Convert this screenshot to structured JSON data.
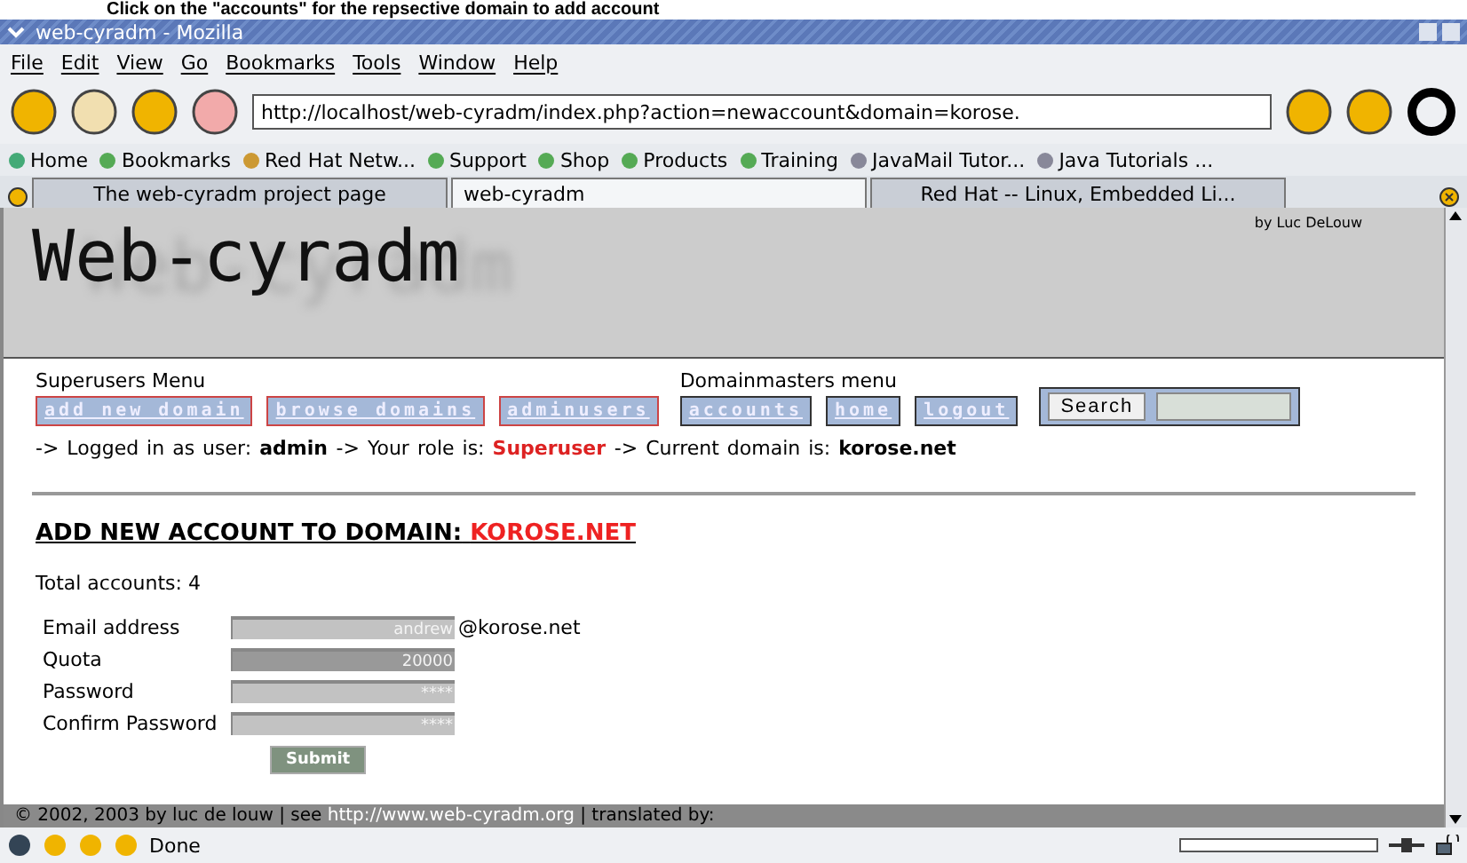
{
  "caption": "Click on the \"accounts\" for the repsective domain to add account",
  "window": {
    "title": "web-cyradm - Mozilla"
  },
  "menu": [
    "File",
    "Edit",
    "View",
    "Go",
    "Bookmarks",
    "Tools",
    "Window",
    "Help"
  ],
  "toolbar": {
    "url": "http://localhost/web-cyradm/index.php?action=newaccount&domain=korose."
  },
  "bookmarks": [
    {
      "label": "Home",
      "kind": "home"
    },
    {
      "label": "Bookmarks",
      "kind": "folder"
    },
    {
      "label": "Red Hat Netw...",
      "kind": "search"
    },
    {
      "label": "Support",
      "kind": "folder"
    },
    {
      "label": "Shop",
      "kind": "folder"
    },
    {
      "label": "Products",
      "kind": "folder"
    },
    {
      "label": "Training",
      "kind": "folder"
    },
    {
      "label": "JavaMail Tutor...",
      "kind": "link"
    },
    {
      "label": "Java Tutorials ...",
      "kind": "link"
    }
  ],
  "tabs": [
    {
      "label": "The web-cyradm project page",
      "selected": false
    },
    {
      "label": "web-cyradm",
      "selected": true
    },
    {
      "label": "Red Hat -- Linux, Embedded Li...",
      "selected": false
    }
  ],
  "page": {
    "logo": "Web-cyradm",
    "credit": "by Luc DeLouw",
    "menus": [
      {
        "title": "Superusers Menu",
        "kind": "super",
        "buttons": [
          "add new domain",
          "browse domains",
          "adminusers"
        ]
      },
      {
        "title": "Domainmasters menu",
        "kind": "domain",
        "buttons": [
          "accounts",
          "home",
          "logout"
        ]
      }
    ],
    "search": {
      "button": "Search"
    },
    "status_line": [
      {
        "text": "-> Logged in as user:",
        "kind": "plain"
      },
      {
        "text": "admin",
        "kind": "bold"
      },
      {
        "text": "-> Your role is:",
        "kind": "plain"
      },
      {
        "text": "Superuser",
        "kind": "alert"
      },
      {
        "text": "-> Current domain is:",
        "kind": "plain"
      },
      {
        "text": "korose.net",
        "kind": "bold"
      }
    ],
    "heading": {
      "text": "ADD NEW ACCOUNT TO DOMAIN:",
      "domain": "KOROSE.NET"
    },
    "total": "Total accounts: 4",
    "fields": [
      {
        "label": "Email address",
        "value": "andrew",
        "suffix": "@korose.net",
        "focused": false
      },
      {
        "label": "Quota",
        "value": "20000",
        "focused": true
      },
      {
        "label": "Password",
        "value": "****",
        "focused": false
      },
      {
        "label": "Confirm Password",
        "value": "****",
        "focused": false
      }
    ],
    "submit": "Submit",
    "footer": {
      "prefix": "© 2002, 2003 by luc de louw | see",
      "link": "http://www.web-cyradm.org",
      "suffix": "| translated by:"
    }
  },
  "status_bar": {
    "text": "Done"
  }
}
